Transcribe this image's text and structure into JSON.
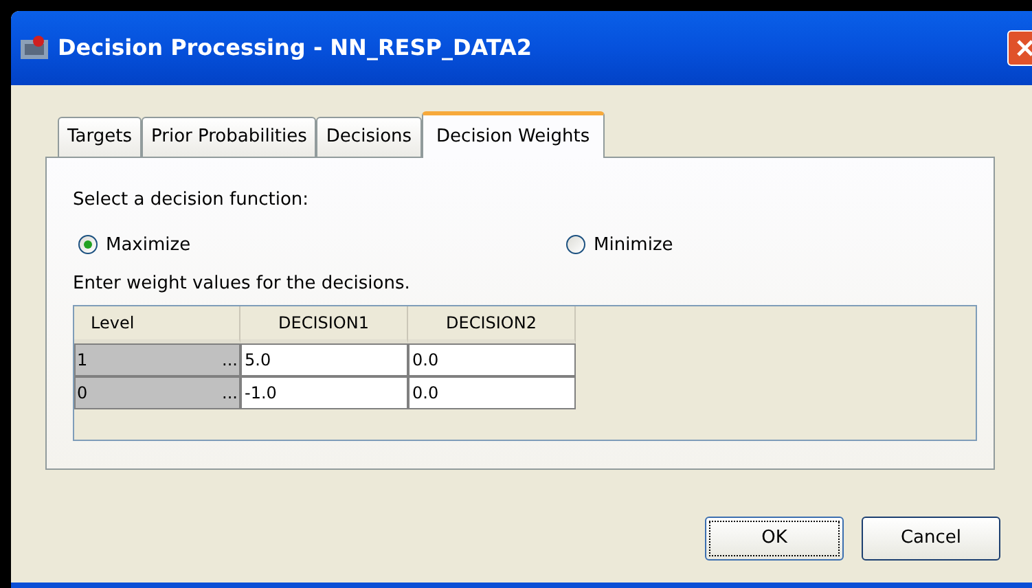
{
  "window": {
    "title": "Decision Processing - NN_RESP_DATA2"
  },
  "tabs": [
    {
      "label": "Targets",
      "selected": false
    },
    {
      "label": "Prior Probabilities",
      "selected": false
    },
    {
      "label": "Decisions",
      "selected": false
    },
    {
      "label": "Decision Weights",
      "selected": true
    }
  ],
  "function_prompt": "Select a decision function:",
  "options": [
    {
      "label": "Maximize",
      "selected": true
    },
    {
      "label": "Minimize",
      "selected": false
    }
  ],
  "table_prompt": "Enter weight values for the decisions.",
  "table": {
    "columns": [
      "Level",
      "DECISION1",
      "DECISION2"
    ],
    "rows": [
      {
        "level": "1",
        "more": "...",
        "values": [
          "5.0",
          "0.0"
        ]
      },
      {
        "level": "0",
        "more": "...",
        "values": [
          "-1.0",
          "0.0"
        ]
      }
    ]
  },
  "buttons": [
    {
      "label": "OK",
      "focused": true
    },
    {
      "label": "Cancel",
      "focused": false
    }
  ]
}
